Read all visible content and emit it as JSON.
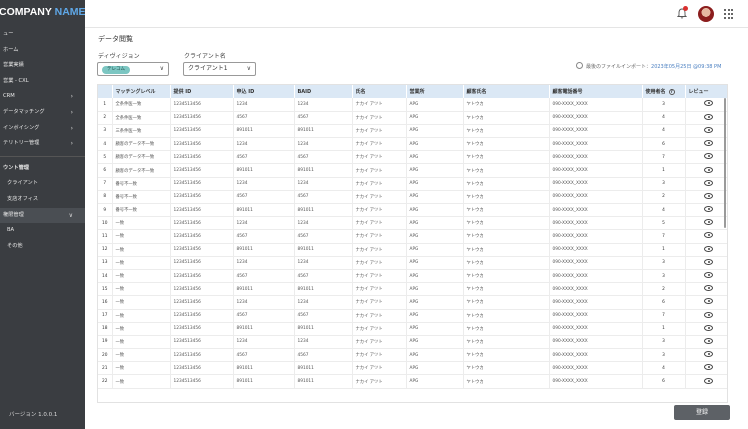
{
  "sidebar": {
    "logo_main": "COMPANY",
    "logo_accent": "NAME",
    "items": [
      {
        "label": "ュー",
        "chevron": false,
        "sub": false,
        "selected": false
      },
      {
        "label": "ホーム",
        "chevron": false,
        "sub": false,
        "selected": false
      },
      {
        "label": "営業実績",
        "chevron": false,
        "sub": false,
        "selected": false
      },
      {
        "label": "営業 - CXL",
        "chevron": false,
        "sub": false,
        "selected": false
      },
      {
        "label": "CRM",
        "chevron": true,
        "sub": false,
        "selected": false
      },
      {
        "label": "データマッチング",
        "chevron": true,
        "sub": false,
        "selected": false
      },
      {
        "label": "インボイシング",
        "chevron": true,
        "sub": false,
        "selected": false
      },
      {
        "label": "テリトリー管理",
        "chevron": true,
        "sub": false,
        "selected": false
      }
    ],
    "section_title": "ウント管理",
    "section_items": [
      {
        "label": "クライアント",
        "chevron": false,
        "sub": true,
        "selected": false
      },
      {
        "label": "支店オフィス",
        "chevron": false,
        "sub": true,
        "selected": false
      },
      {
        "label": "権限管理",
        "chevron": true,
        "sub": false,
        "selected": true
      },
      {
        "label": "BA",
        "chevron": false,
        "sub": true,
        "selected": false
      },
      {
        "label": "その他",
        "chevron": false,
        "sub": true,
        "selected": false
      }
    ],
    "version": "バージョン 1.0.0.1"
  },
  "page": {
    "title": "データ閲覧",
    "division_label": "ディヴィジョン",
    "division_chip": "テレコム",
    "client_label": "クライアント名",
    "client_value": "クライアント1",
    "import_prefix": "最後のファイルインポート：",
    "import_timestamp": "2023年05月25日 @09:38 PM"
  },
  "table": {
    "headers": [
      "",
      "マッチングレベル",
      "提供 ID",
      "申込 ID",
      "BAID",
      "氏名",
      "営業所",
      "顧客氏名",
      "顧客電話番号",
      "使用者名",
      "レビュー"
    ],
    "rows": [
      [
        "1",
        "全条件医一致",
        "1234513456",
        "1234",
        "1234",
        "ナカイ アツト",
        "APG",
        "ヤトウカ",
        "090-XXXX_XXXX",
        "3"
      ],
      [
        "2",
        "全条件医一致",
        "1234513456",
        "4567",
        "4567",
        "ナカイ アツト",
        "APG",
        "ヤトウカ",
        "090-XXXX_XXXX",
        "4"
      ],
      [
        "3",
        "三条件医一致",
        "1234513456",
        "891011",
        "891011",
        "ナカイ アツト",
        "APG",
        "ヤトウカ",
        "090-XXXX_XXXX",
        "4"
      ],
      [
        "4",
        "顧客のデータ不一致",
        "1234513456",
        "1234",
        "1234",
        "ナカイ アツト",
        "APG",
        "ヤトウカ",
        "090-XXXX_XXXX",
        "6"
      ],
      [
        "5",
        "顧客のデータ不一致",
        "1234513456",
        "4567",
        "4567",
        "ナカイ アツト",
        "APG",
        "ヤトウカ",
        "090-XXXX_XXXX",
        "7"
      ],
      [
        "6",
        "顧客のデータ不一致",
        "1234513456",
        "891011",
        "891011",
        "ナカイ アツト",
        "APG",
        "ヤトウカ",
        "090-XXXX_XXXX",
        "1"
      ],
      [
        "7",
        "番号不一致",
        "1234513456",
        "1234",
        "1234",
        "ナカイ アツト",
        "APG",
        "ヤトウカ",
        "090-XXXX_XXXX",
        "3"
      ],
      [
        "8",
        "番号不一致",
        "1234513456",
        "4567",
        "4567",
        "ナカイ アツト",
        "APG",
        "ヤトウカ",
        "090-XXXX_XXXX",
        "2"
      ],
      [
        "9",
        "番号不一致",
        "1234513456",
        "891011",
        "891011",
        "ナカイ アツト",
        "APG",
        "ヤトウカ",
        "090-XXXX_XXXX",
        "4"
      ],
      [
        "10",
        "一致",
        "1234513456",
        "1234",
        "1234",
        "ナカイ アツト",
        "APG",
        "ヤトウカ",
        "090-XXXX_XXXX",
        "5"
      ],
      [
        "11",
        "一致",
        "1234513456",
        "4567",
        "4567",
        "ナカイ アツト",
        "APG",
        "ヤトウカ",
        "090-XXXX_XXXX",
        "7"
      ],
      [
        "12",
        "一致",
        "1234513456",
        "891011",
        "891011",
        "ナカイ アツト",
        "APG",
        "ヤトウカ",
        "090-XXXX_XXXX",
        "1"
      ],
      [
        "13",
        "一致",
        "1234513456",
        "1234",
        "1234",
        "ナカイ アツト",
        "APG",
        "ヤトウカ",
        "090-XXXX_XXXX",
        "3"
      ],
      [
        "14",
        "一致",
        "1234513456",
        "4567",
        "4567",
        "ナカイ アツト",
        "APG",
        "ヤトウカ",
        "090-XXXX_XXXX",
        "3"
      ],
      [
        "15",
        "一致",
        "1234513456",
        "891011",
        "891011",
        "ナカイ アツト",
        "APG",
        "ヤトウカ",
        "090-XXXX_XXXX",
        "2"
      ],
      [
        "16",
        "一致",
        "1234513456",
        "1234",
        "1234",
        "ナカイ アツト",
        "APG",
        "ヤトウカ",
        "090-XXXX_XXXX",
        "6"
      ],
      [
        "17",
        "一致",
        "1234513456",
        "4567",
        "4567",
        "ナカイ アツト",
        "APG",
        "ヤトウカ",
        "090-XXXX_XXXX",
        "7"
      ],
      [
        "18",
        "一致",
        "1234513456",
        "891011",
        "891011",
        "ナカイ アツト",
        "APG",
        "ヤトウカ",
        "090-XXXX_XXXX",
        "1"
      ],
      [
        "19",
        "一致",
        "1234513456",
        "1234",
        "1234",
        "ナカイ アツト",
        "APG",
        "ヤトウカ",
        "090-XXXX_XXXX",
        "3"
      ],
      [
        "20",
        "一致",
        "1234513456",
        "4567",
        "4567",
        "ナカイ アツト",
        "APG",
        "ヤトウカ",
        "090-XXXX_XXXX",
        "3"
      ],
      [
        "21",
        "一致",
        "1234513456",
        "891011",
        "891011",
        "ナカイ アツト",
        "APG",
        "ヤトウカ",
        "090-XXXX_XXXX",
        "4"
      ],
      [
        "22",
        "一致",
        "1234513456",
        "891011",
        "891011",
        "ナカイ アツト",
        "APG",
        "ヤトウカ",
        "090-XXXX_XXXX",
        "6"
      ]
    ]
  },
  "footer": {
    "register_label": "登録"
  },
  "icons": {
    "bell": "bell-icon",
    "avatar": "user-avatar",
    "apps": "apps-grid-icon",
    "clock": "clock-icon",
    "review": "eye-icon",
    "help": "help-icon"
  },
  "colors": {
    "sidebar_bg": "#3a3d41",
    "header_bg": "#dbe8f5",
    "chip_bg": "#7cc6c2",
    "logo_accent": "#5fa8e8",
    "button_bg": "#5d6166",
    "badge": "#d9302f"
  }
}
